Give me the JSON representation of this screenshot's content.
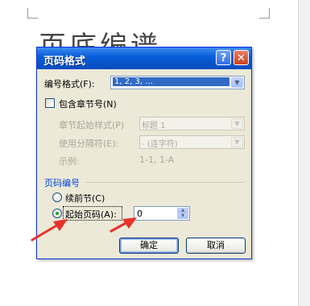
{
  "document": {
    "title_fragment": "页底编谱"
  },
  "dialog": {
    "title": "页码格式",
    "help_label": "?",
    "close_label": "✕",
    "number_format": {
      "label": "编号格式(F):",
      "value": "1, 2, 3, …"
    },
    "include_chapter": {
      "label": "包含章节号(N)",
      "checked": false
    },
    "chapter_style": {
      "label": "章节起始样式(P)",
      "value": "标题 1"
    },
    "separator": {
      "label": "使用分隔符(E):",
      "value": "-   (连字符)"
    },
    "example": {
      "label": "示例:",
      "value": "1-1, 1-A"
    },
    "page_numbering": {
      "group_title": "页码编号",
      "continue_label": "续前节(C)",
      "start_at_label": "起始页码(A):",
      "start_at_value": "0",
      "selected": "start_at"
    },
    "ok_label": "确定",
    "cancel_label": "取消"
  },
  "colors": {
    "annotation_arrow": "#e8322a",
    "titlebar": "#0a5fd8",
    "group_title": "#0046d5"
  }
}
